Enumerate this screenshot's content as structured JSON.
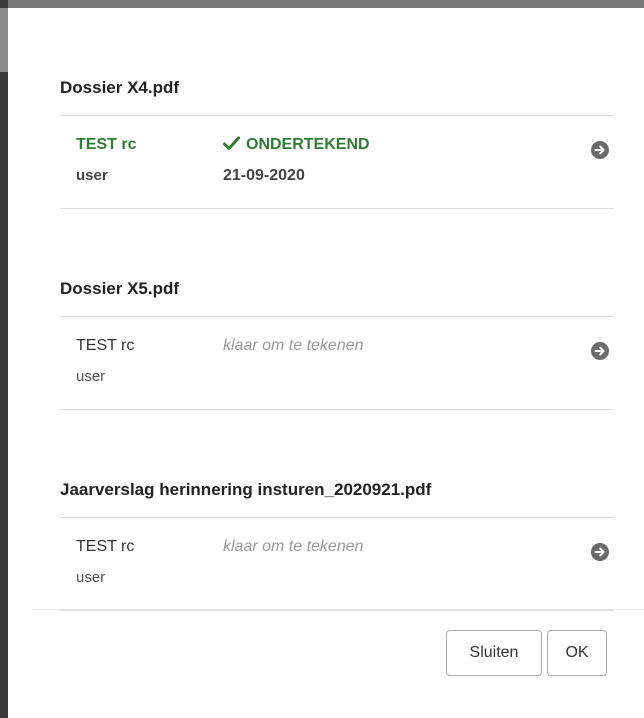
{
  "documents": [
    {
      "title": "Dossier X4.pdf",
      "signer_name": "TEST rc",
      "signer_role": "user",
      "status": "ONDERTEKEND",
      "signed": true,
      "date": "21-09-2020"
    },
    {
      "title": "Dossier X5.pdf",
      "signer_name": "TEST rc",
      "signer_role": "user",
      "status": "klaar om te tekenen",
      "signed": false,
      "date": ""
    },
    {
      "title": "Jaarverslag herinnering insturen_2020921.pdf",
      "signer_name": "TEST rc",
      "signer_role": "user",
      "status": "klaar om te tekenen",
      "signed": false,
      "date": ""
    }
  ],
  "footer": {
    "close_label": "Sluiten",
    "ok_label": "OK"
  },
  "colors": {
    "signed_green": "#2e7d32",
    "pending_grey": "#999999",
    "arrow_grey": "#6b6b6b"
  },
  "icons": {
    "signed_status": "check-icon",
    "row_action": "arrow-circle-right-icon"
  }
}
